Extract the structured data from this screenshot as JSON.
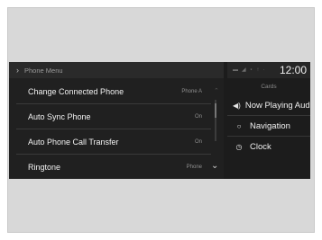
{
  "header": {
    "breadcrumb": "Phone Menu",
    "time": "12:00"
  },
  "menu": {
    "items": [
      {
        "label": "Change Connected Phone",
        "value": "Phone A"
      },
      {
        "label": "Auto Sync Phone",
        "value": "On"
      },
      {
        "label": "Auto Phone Call Transfer",
        "value": "On"
      },
      {
        "label": "Ringtone",
        "value": "Phone"
      }
    ]
  },
  "cards": {
    "title": "Cards",
    "items": [
      {
        "label": "Now Playing Audio",
        "icon": "speaker-icon"
      },
      {
        "label": "Navigation",
        "icon": "navigation-icon"
      },
      {
        "label": "Clock",
        "icon": "clock-icon"
      }
    ]
  },
  "status_icons": [
    "battery-icon",
    "signal-icon",
    "bluetooth-icon",
    "wifi-icon",
    "data-icon"
  ],
  "colors": {
    "screen_bg": "#1c1c1c",
    "frame_bg": "#d8d8d8",
    "text_primary": "#f2f2f2",
    "text_secondary": "#8e8e8e"
  }
}
